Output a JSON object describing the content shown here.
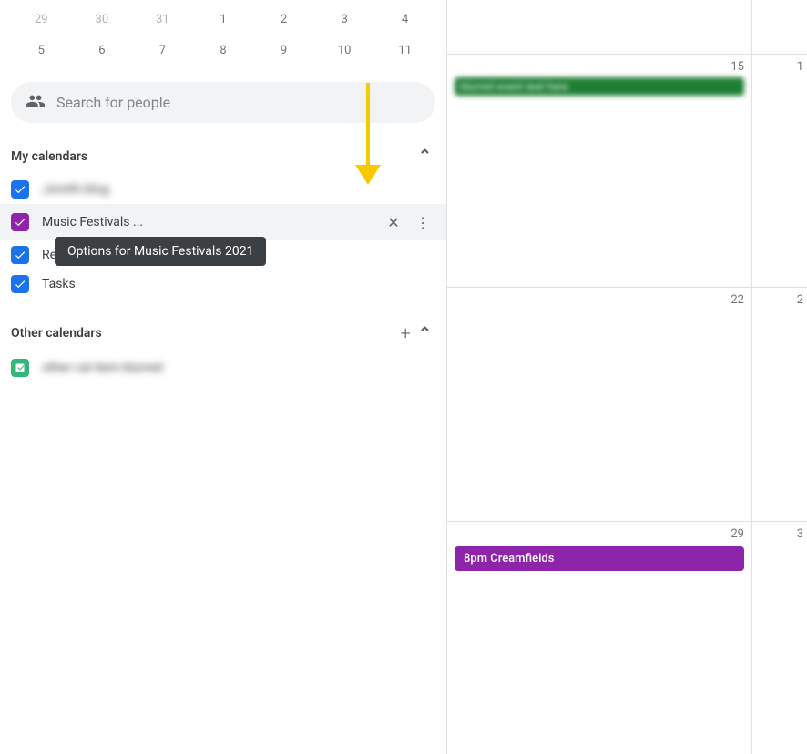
{
  "mini_cal": {
    "rows": [
      [
        {
          "val": "29",
          "faded": true
        },
        {
          "val": "30",
          "faded": true
        },
        {
          "val": "31",
          "faded": true
        },
        {
          "val": "1",
          "faded": false
        },
        {
          "val": "2",
          "faded": false
        },
        {
          "val": "3",
          "faded": false
        },
        {
          "val": "4",
          "faded": false
        }
      ],
      [
        {
          "val": "5",
          "faded": false
        },
        {
          "val": "6",
          "faded": false
        },
        {
          "val": "7",
          "faded": false
        },
        {
          "val": "8",
          "faded": false
        },
        {
          "val": "9",
          "faded": false
        },
        {
          "val": "10",
          "faded": false
        },
        {
          "val": "11",
          "faded": false
        }
      ]
    ]
  },
  "search": {
    "placeholder": "Search for people"
  },
  "my_calendars": {
    "label": "My calendars",
    "items": [
      {
        "name_blurred": true,
        "name": "Jsmith.blog",
        "color": "#1a73e8",
        "checked": true
      },
      {
        "name": "Music Festivals ...",
        "color": "#8e24aa",
        "checked": true,
        "highlighted": true,
        "show_actions": true
      },
      {
        "name": "Reminders",
        "color": "#1a73e8",
        "checked": true,
        "show_actions": false
      },
      {
        "name": "Tasks",
        "color": "#1a73e8",
        "checked": true,
        "show_actions": false
      }
    ]
  },
  "other_calendars": {
    "label": "Other calendars",
    "items": [
      {
        "name_blurred": true,
        "name": "other calendar item",
        "color": "#33b679"
      }
    ]
  },
  "tooltip": {
    "text": "Options for Music Festivals 2021"
  },
  "calendar": {
    "weeks": [
      {
        "main_day": "15",
        "right_day": "1",
        "events": [
          {
            "text": "blurred event text here",
            "color": "green",
            "blurred": true
          }
        ]
      },
      {
        "main_day": "22",
        "right_day": "2",
        "events": []
      },
      {
        "main_day": "29",
        "right_day": "3",
        "events": [
          {
            "text": "8pm Creamfields",
            "color": "#8e24aa",
            "blurred": false
          }
        ]
      }
    ]
  },
  "arrow": {
    "color": "#f9c900"
  }
}
